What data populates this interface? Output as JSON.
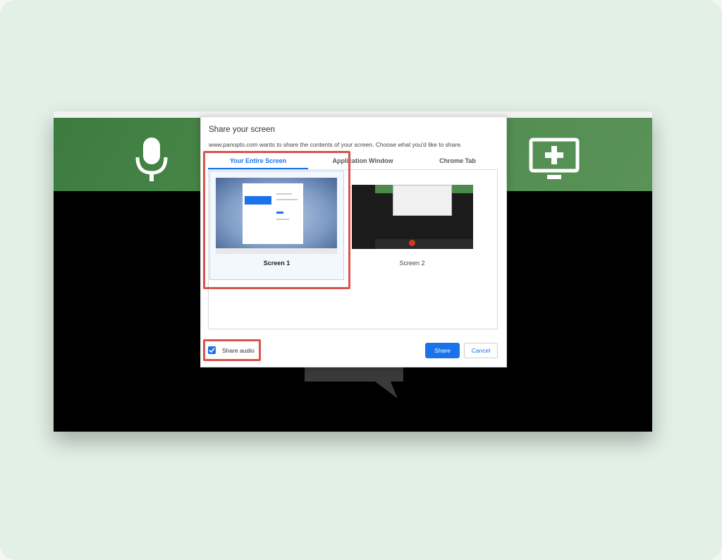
{
  "dialog": {
    "title": "Share your screen",
    "subtitle": "www.panopto.com wants to share the contents of your screen. Choose what you'd like to share.",
    "tabs": [
      {
        "label": "Your Entire Screen",
        "active": true
      },
      {
        "label": "Application Window",
        "active": false
      },
      {
        "label": "Chrome Tab",
        "active": false
      }
    ],
    "sources": [
      {
        "label": "Screen 1",
        "selected": true
      },
      {
        "label": "Screen 2",
        "selected": false
      }
    ],
    "share_audio": {
      "label": "Share audio",
      "checked": true
    },
    "buttons": {
      "share": "Share",
      "cancel": "Cancel"
    }
  },
  "background_app": {
    "icons": [
      "microphone-icon",
      "add-screen-icon",
      "chat-bubble-icon"
    ]
  },
  "colors": {
    "accent": "#1a73e8",
    "highlight": "#d9534f",
    "band_green": "#4d8a4c",
    "card_bg": "#e2f0e6"
  }
}
